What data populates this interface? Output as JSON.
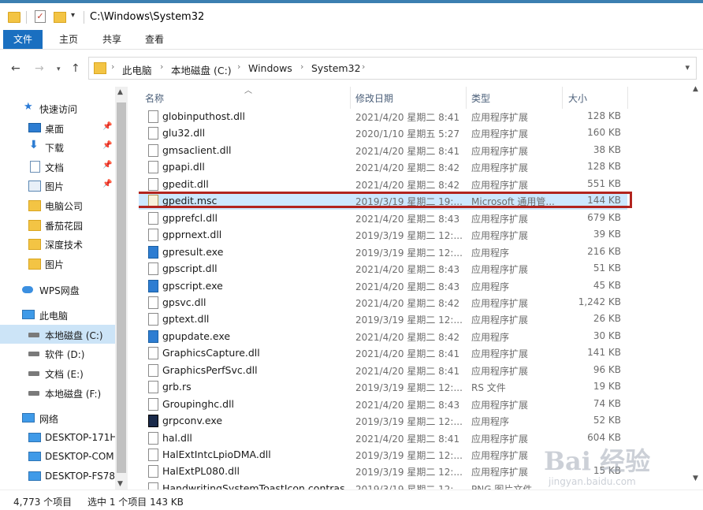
{
  "window": {
    "title_path": "C:\\Windows\\System32"
  },
  "ribbon": {
    "tabs": [
      "文件",
      "主页",
      "共享",
      "查看"
    ]
  },
  "address": {
    "crumbs": [
      "此电脑",
      "本地磁盘 (C:)",
      "Windows",
      "System32"
    ]
  },
  "sidebar": {
    "items": [
      {
        "label": "快速访问",
        "icon": "star-icon",
        "pinned": false
      },
      {
        "label": "桌面",
        "icon": "desktop-icon",
        "pinned": true
      },
      {
        "label": "下载",
        "icon": "download-icon",
        "pinned": true
      },
      {
        "label": "文档",
        "icon": "document-icon",
        "pinned": true
      },
      {
        "label": "图片",
        "icon": "picture-icon",
        "pinned": true
      },
      {
        "label": "电脑公司",
        "icon": "folder-icon",
        "pinned": false
      },
      {
        "label": "番茄花园",
        "icon": "folder-icon",
        "pinned": false
      },
      {
        "label": "深度技术",
        "icon": "folder-icon",
        "pinned": false
      },
      {
        "label": "图片",
        "icon": "folder-icon",
        "pinned": false
      },
      {
        "label": "WPS网盘",
        "icon": "cloud-icon",
        "pinned": false
      },
      {
        "label": "此电脑",
        "icon": "computer-icon",
        "pinned": false
      },
      {
        "label": "本地磁盘 (C:)",
        "icon": "drive-icon",
        "pinned": false,
        "selected": true
      },
      {
        "label": "软件 (D:)",
        "icon": "drive-icon",
        "pinned": false
      },
      {
        "label": "文档 (E:)",
        "icon": "drive-icon",
        "pinned": false
      },
      {
        "label": "本地磁盘 (F:)",
        "icon": "drive-icon",
        "pinned": false
      },
      {
        "label": "网络",
        "icon": "network-icon",
        "pinned": false
      },
      {
        "label": "DESKTOP-171H",
        "icon": "monitor-icon",
        "pinned": false
      },
      {
        "label": "DESKTOP-COM",
        "icon": "monitor-icon",
        "pinned": false
      },
      {
        "label": "DESKTOP-FS78",
        "icon": "monitor-icon",
        "pinned": false
      }
    ]
  },
  "columns": {
    "name": "名称",
    "date": "修改日期",
    "type": "类型",
    "size": "大小"
  },
  "files": [
    {
      "name": "globinputhost.dll",
      "date": "2021/4/20 星期二 8:41",
      "type": "应用程序扩展",
      "size": "128 KB",
      "kind": "dll"
    },
    {
      "name": "glu32.dll",
      "date": "2020/1/10 星期五 5:27",
      "type": "应用程序扩展",
      "size": "160 KB",
      "kind": "dll"
    },
    {
      "name": "gmsaclient.dll",
      "date": "2021/4/20 星期二 8:41",
      "type": "应用程序扩展",
      "size": "38 KB",
      "kind": "dll"
    },
    {
      "name": "gpapi.dll",
      "date": "2021/4/20 星期二 8:42",
      "type": "应用程序扩展",
      "size": "128 KB",
      "kind": "dll"
    },
    {
      "name": "gpedit.dll",
      "date": "2021/4/20 星期二 8:42",
      "type": "应用程序扩展",
      "size": "551 KB",
      "kind": "dll"
    },
    {
      "name": "gpedit.msc",
      "date": "2019/3/19 星期二 19:...",
      "type": "Microsoft 通用管...",
      "size": "144 KB",
      "kind": "msc",
      "selected": true
    },
    {
      "name": "gpprefcl.dll",
      "date": "2021/4/20 星期二 8:43",
      "type": "应用程序扩展",
      "size": "679 KB",
      "kind": "dll"
    },
    {
      "name": "gpprnext.dll",
      "date": "2019/3/19 星期二 12:...",
      "type": "应用程序扩展",
      "size": "39 KB",
      "kind": "dll"
    },
    {
      "name": "gpresult.exe",
      "date": "2019/3/19 星期二 12:...",
      "type": "应用程序",
      "size": "216 KB",
      "kind": "exe"
    },
    {
      "name": "gpscript.dll",
      "date": "2021/4/20 星期二 8:43",
      "type": "应用程序扩展",
      "size": "51 KB",
      "kind": "dll"
    },
    {
      "name": "gpscript.exe",
      "date": "2021/4/20 星期二 8:43",
      "type": "应用程序",
      "size": "45 KB",
      "kind": "exe"
    },
    {
      "name": "gpsvc.dll",
      "date": "2021/4/20 星期二 8:42",
      "type": "应用程序扩展",
      "size": "1,242 KB",
      "kind": "dll"
    },
    {
      "name": "gptext.dll",
      "date": "2019/3/19 星期二 12:...",
      "type": "应用程序扩展",
      "size": "26 KB",
      "kind": "dll"
    },
    {
      "name": "gpupdate.exe",
      "date": "2021/4/20 星期二 8:42",
      "type": "应用程序",
      "size": "30 KB",
      "kind": "exe"
    },
    {
      "name": "GraphicsCapture.dll",
      "date": "2021/4/20 星期二 8:41",
      "type": "应用程序扩展",
      "size": "141 KB",
      "kind": "dll"
    },
    {
      "name": "GraphicsPerfSvc.dll",
      "date": "2021/4/20 星期二 8:41",
      "type": "应用程序扩展",
      "size": "96 KB",
      "kind": "dll"
    },
    {
      "name": "grb.rs",
      "date": "2019/3/19 星期二 12:...",
      "type": "RS 文件",
      "size": "19 KB",
      "kind": "file"
    },
    {
      "name": "Groupinghc.dll",
      "date": "2021/4/20 星期二 8:43",
      "type": "应用程序扩展",
      "size": "74 KB",
      "kind": "dll"
    },
    {
      "name": "grpconv.exe",
      "date": "2019/3/19 星期二 12:...",
      "type": "应用程序",
      "size": "52 KB",
      "kind": "ms"
    },
    {
      "name": "hal.dll",
      "date": "2021/4/20 星期二 8:41",
      "type": "应用程序扩展",
      "size": "604 KB",
      "kind": "dll"
    },
    {
      "name": "HalExtIntcLpioDMA.dll",
      "date": "2019/3/19 星期二 12:...",
      "type": "应用程序扩展",
      "size": "",
      "kind": "dll"
    },
    {
      "name": "HalExtPL080.dll",
      "date": "2019/3/19 星期二 12:...",
      "type": "应用程序扩展",
      "size": "15 KB",
      "kind": "dll"
    },
    {
      "name": "HandwritingSystemToastIcon.contras",
      "date": "2019/3/19 星期二 12:...",
      "type": "PNG 图片文件",
      "size": "",
      "kind": "file"
    }
  ],
  "status": {
    "count": "4,773 个项目",
    "selection": "选中 1 个项目  143 KB"
  },
  "watermark": {
    "brand": "Bai 经验",
    "url": "jingyan.baidu.com"
  }
}
